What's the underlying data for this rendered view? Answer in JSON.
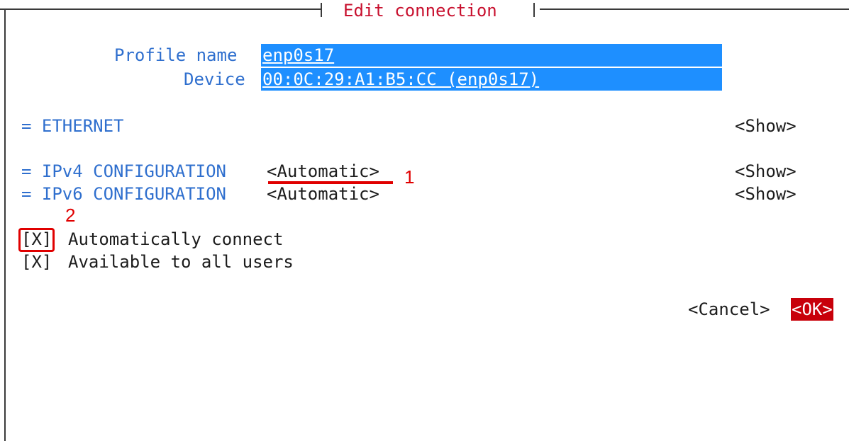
{
  "dialog": {
    "title": "Edit connection"
  },
  "profile": {
    "name_label": "Profile name",
    "name_value": "enp0s17",
    "device_label": "Device",
    "device_value": "00:0C:29:A1:B5:CC (enp0s17)"
  },
  "sections": [
    {
      "label": "= ETHERNET",
      "mode": "",
      "action": "<Show>"
    },
    {
      "label": "= IPv4 CONFIGURATION",
      "mode": "<Automatic>",
      "action": "<Show>"
    },
    {
      "label": "= IPv6 CONFIGURATION",
      "mode": "<Automatic>",
      "action": "<Show>"
    }
  ],
  "checkboxes": [
    {
      "mark": "[X]",
      "label": "Automatically connect"
    },
    {
      "mark": "[X]",
      "label": "Available to all users"
    }
  ],
  "buttons": {
    "cancel": "<Cancel>",
    "ok": "<OK>"
  },
  "annotations": {
    "marker_1": "1",
    "marker_2": "2"
  },
  "colors": {
    "title": "#c8102e",
    "label_blue": "#2f6fce",
    "field_bg": "#1e8fff",
    "ok_bg": "#c8000a",
    "annotation_red": "#e00000"
  }
}
